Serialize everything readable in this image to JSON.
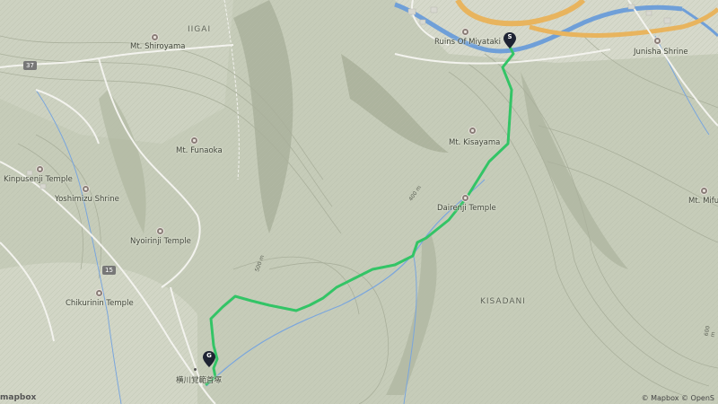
{
  "map": {
    "regions": {
      "iigai": "IIGAI",
      "kisadani": "KISADANI"
    },
    "pois": [
      {
        "name": "Mt. Shiroyama"
      },
      {
        "name": "Mt. Funaoka"
      },
      {
        "name": "Kinpusenji Temple"
      },
      {
        "name": "Yoshimizu Shrine"
      },
      {
        "name": "Nyoirinji Temple"
      },
      {
        "name": "Chikurinin Temple"
      },
      {
        "name": "Ruins Of Miyataki"
      },
      {
        "name": "Junisha Shrine"
      },
      {
        "name": "Mt. Kisayama"
      },
      {
        "name": "Dairenji Temple"
      },
      {
        "name": "Mt. Mifun"
      },
      {
        "name": "横川覚範首塚"
      }
    ],
    "roads": {
      "route_37": "37",
      "route_15": "15"
    },
    "contours": {
      "c400": "400 m",
      "c500": "500 m",
      "c600": "600 m"
    },
    "markers": {
      "start": "S",
      "goal": "G"
    },
    "route_color": "#33c466",
    "attribution": "© Mapbox © OpenS",
    "logo": "mapbox"
  }
}
